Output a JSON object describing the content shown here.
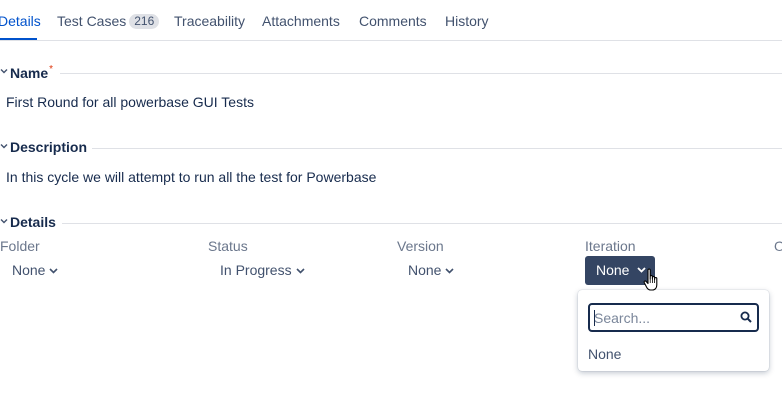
{
  "tabs": [
    {
      "label": "Details",
      "active": true
    },
    {
      "label": "Test Cases",
      "count": "216"
    },
    {
      "label": "Traceability"
    },
    {
      "label": "Attachments"
    },
    {
      "label": "Comments"
    },
    {
      "label": "History"
    }
  ],
  "name_section": {
    "title": "Name",
    "required_mark": "*",
    "value": "First Round for all powerbase GUI Tests"
  },
  "description_section": {
    "title": "Description",
    "value": "In this cycle we will attempt to run all the test for Powerbase"
  },
  "details_section": {
    "title": "Details",
    "fields": {
      "folder": {
        "label": "Folder",
        "value": "None"
      },
      "status": {
        "label": "Status",
        "value": "In Progress"
      },
      "version": {
        "label": "Version",
        "value": "None"
      },
      "iteration": {
        "label": "Iteration",
        "value": "None"
      },
      "next_label_partial": "O"
    }
  },
  "iteration_dropdown": {
    "search_placeholder": "Search...",
    "options": [
      "None"
    ]
  },
  "colors": {
    "accent": "#0052cc",
    "active_button_bg": "#344563",
    "required": "#de350b"
  }
}
